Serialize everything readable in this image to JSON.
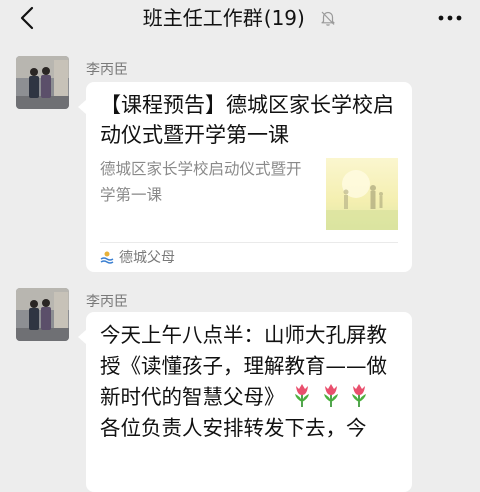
{
  "header": {
    "title": "班主任工作群",
    "member_count": "(19)",
    "back_icon": "chevron-left-icon",
    "mute_icon": "bell-off-icon",
    "more_icon": "more-dots-icon"
  },
  "messages": [
    {
      "sender": "李丙臣",
      "type": "link-card",
      "card": {
        "title": "【课程预告】德城区家长学校启动仪式暨开学第一课",
        "description": "德城区家长学校启动仪式暨开学第一课",
        "source": "德城父母",
        "source_icon": "official-account-icon"
      }
    },
    {
      "sender": "李丙臣",
      "type": "text",
      "text": {
        "part1": "今天上午八点半：山师大孔屏教授《读懂孩子，理解教育——做新时代的智慧父母》",
        "part2": "各位负责人安排转发下去，今"
      },
      "emoji": "tulip"
    }
  ],
  "colors": {
    "background": "#ededed",
    "bubble": "#ffffff",
    "secondary_text": "#8a8a8a"
  }
}
